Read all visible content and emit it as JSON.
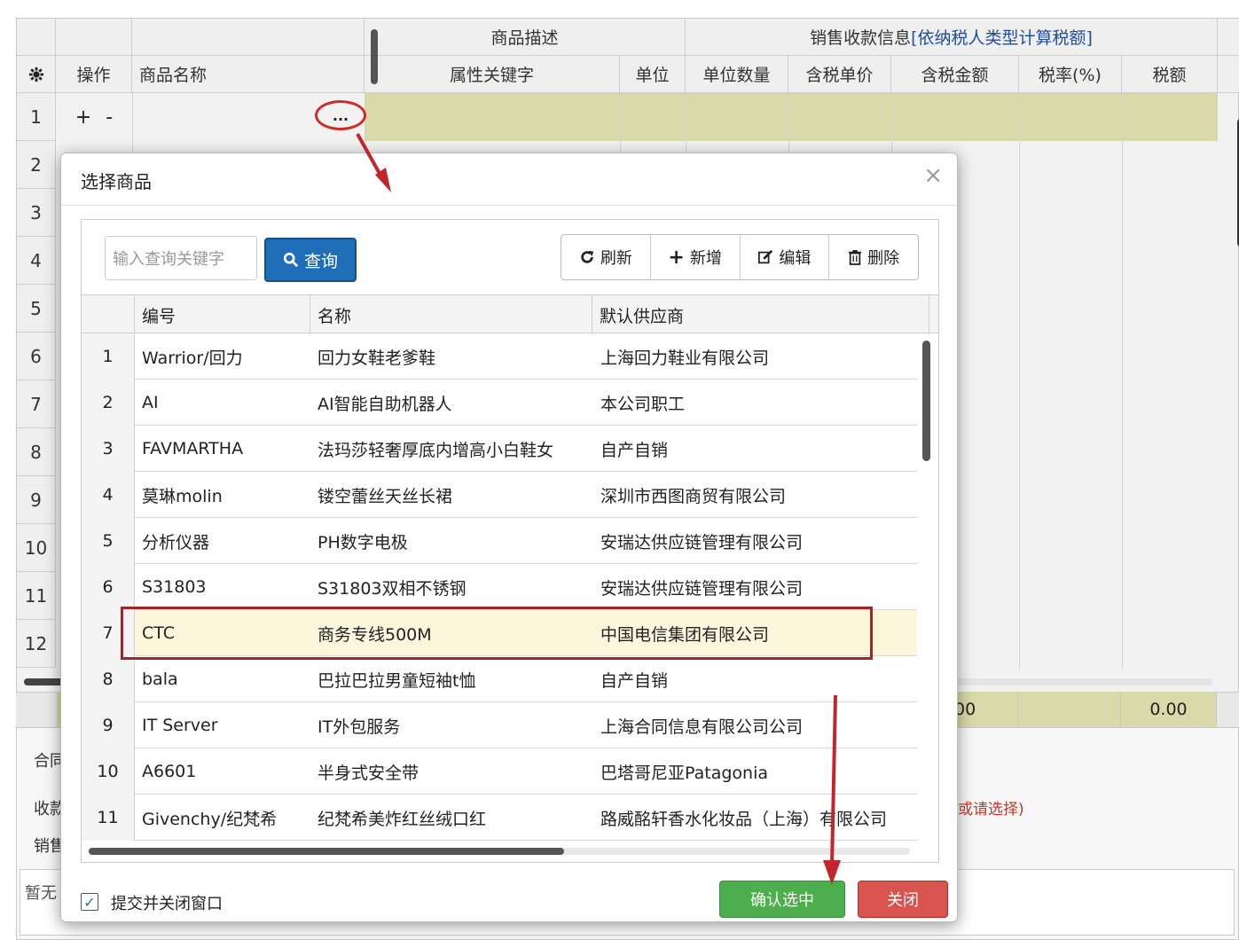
{
  "grid": {
    "groups": {
      "desc": "商品描述",
      "sales": "销售收款信息",
      "sales_link": "[依纳税人类型计算税额]"
    },
    "headers": {
      "settings_icon": "gear-icon",
      "op": "操作",
      "name": "商品名称",
      "attr": "属性关键字",
      "unit": "单位",
      "qty": "单位数量",
      "unit_price": "含税单价",
      "amount": "含税金额",
      "tax_rate": "税率(%)",
      "tax": "税额"
    },
    "rows": [
      "1",
      "2",
      "3",
      "4",
      "5",
      "6",
      "7",
      "8",
      "9",
      "10",
      "11",
      "12"
    ],
    "row1_ops": {
      "add": "+",
      "remove": "-",
      "pick": "..."
    },
    "totals": {
      "partial": "00",
      "tax": "0.00"
    },
    "side_labels": {
      "contract": "合同",
      "receive": "收款",
      "sales": "销售"
    },
    "hint": "或请选择)",
    "empty": "暂无"
  },
  "dialog": {
    "title": "选择商品",
    "close": "×",
    "search": {
      "placeholder": "输入查询关键字",
      "button": "查询"
    },
    "toolbar": {
      "refresh": "刷新",
      "add": "新增",
      "edit": "编辑",
      "delete": "删除"
    },
    "columns": {
      "code": "编号",
      "name": "名称",
      "supplier": "默认供应商"
    },
    "items": [
      {
        "no": "1",
        "code": "Warrior/回力",
        "name": "回力女鞋老爹鞋",
        "supplier": "上海回力鞋业有限公司"
      },
      {
        "no": "2",
        "code": "AI",
        "name": "AI智能自助机器人",
        "supplier": "本公司职工"
      },
      {
        "no": "3",
        "code": "FAVMARTHA",
        "name": "法玛莎轻奢厚底内增高小白鞋女",
        "supplier": "自产自销"
      },
      {
        "no": "4",
        "code": "莫琳molin",
        "name": "镂空蕾丝天丝长裙",
        "supplier": "深圳市西图商贸有限公司"
      },
      {
        "no": "5",
        "code": "分析仪器",
        "name": "PH数字电极",
        "supplier": "安瑞达供应链管理有限公司"
      },
      {
        "no": "6",
        "code": "S31803",
        "name": "S31803双相不锈钢",
        "supplier": "安瑞达供应链管理有限公司"
      },
      {
        "no": "7",
        "code": "CTC",
        "name": "商务专线500M",
        "supplier": "中国电信集团有限公司"
      },
      {
        "no": "8",
        "code": "bala",
        "name": "巴拉巴拉男童短袖t恤",
        "supplier": "自产自销"
      },
      {
        "no": "9",
        "code": "IT Server",
        "name": "IT外包服务",
        "supplier": "上海合同信息有限公司公司"
      },
      {
        "no": "10",
        "code": "A6601",
        "name": "半身式安全带",
        "supplier": "巴塔哥尼亚Patagonia"
      },
      {
        "no": "11",
        "code": "Givenchy/纪梵希",
        "name": "纪梵希美炸红丝绒口红",
        "supplier": "路威酩轩香水化妆品（上海）有限公司"
      }
    ],
    "selected_index": 6,
    "footer": {
      "checkbox_label": "提交并关闭窗口",
      "checked": true,
      "confirm": "确认选中",
      "close": "关闭"
    }
  },
  "colors": {
    "accent_blue": "#1f6fb8",
    "confirm_green": "#4cae4c",
    "close_red": "#d9534f",
    "highlight_red": "#a0262a",
    "selected_row": "#fbf6dc"
  }
}
